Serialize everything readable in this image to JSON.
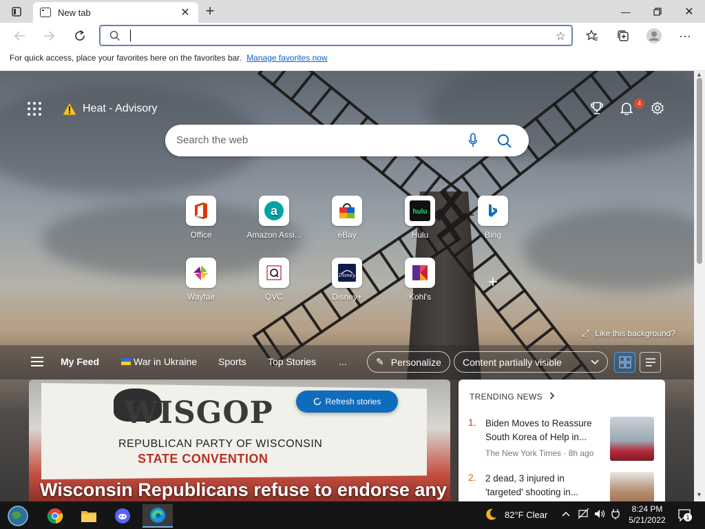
{
  "browser": {
    "tab_title": "New tab",
    "favorites_message": "For quick access, place your favorites here on the favorites bar.",
    "manage_favorites": "Manage favorites now"
  },
  "ntp": {
    "weather_alert": "Heat - Advisory",
    "notification_count": "4",
    "search_placeholder": "Search the web",
    "tiles": [
      {
        "label": "Office"
      },
      {
        "label": "Amazon Assi..."
      },
      {
        "label": "eBay"
      },
      {
        "label": "Hulu"
      },
      {
        "label": "Bing"
      },
      {
        "label": "Wayfair"
      },
      {
        "label": "QVC"
      },
      {
        "label": "Disney+"
      },
      {
        "label": "Kohl's"
      }
    ],
    "like_background": "Like this background?"
  },
  "feed": {
    "tabs": [
      "My Feed",
      "War in Ukraine",
      "Sports",
      "Top Stories",
      "..."
    ],
    "personalize": "Personalize",
    "visibility": "Content partially visible",
    "refresh": "Refresh stories"
  },
  "hero": {
    "banner_line1": "WISGOP",
    "banner_line2": "REPUBLICAN PARTY OF WISCONSIN",
    "banner_line3": "STATE CONVENTION",
    "title": "Wisconsin Republicans refuse to endorse any"
  },
  "trending": {
    "header": "TRENDING NEWS",
    "items": [
      {
        "num": "1.",
        "title": "Biden Moves to Reassure South Korea of Help in...",
        "source": "The New York Times · 8h ago"
      },
      {
        "num": "2.",
        "title": "2 dead, 3 injured in 'targeted' shooting in...",
        "source": ""
      }
    ]
  },
  "taskbar": {
    "weather": "82°F  Clear",
    "time": "8:24 PM",
    "date": "5/21/2022",
    "notifications": "1"
  }
}
